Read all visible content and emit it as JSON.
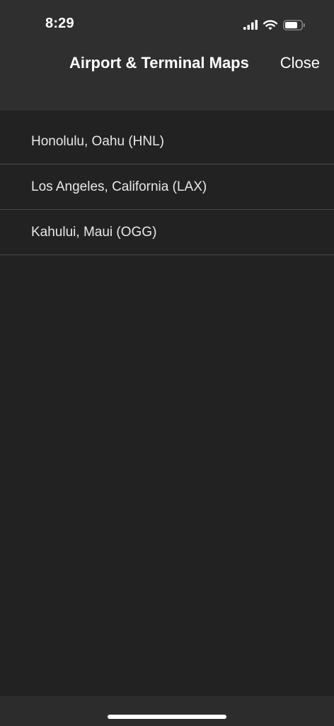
{
  "status_bar": {
    "time": "8:29"
  },
  "nav": {
    "title": "Airport & Terminal Maps",
    "close_label": "Close"
  },
  "airports": [
    {
      "label": "Honolulu, Oahu (HNL)"
    },
    {
      "label": "Los Angeles, California (LAX)"
    },
    {
      "label": "Kahului, Maui (OGG)"
    }
  ],
  "icons": {
    "signal": "cellular-signal-icon",
    "wifi": "wifi-icon",
    "battery": "battery-icon"
  },
  "colors": {
    "background": "#222222",
    "header": "#2f2f2f",
    "divider": "#4a4a4a",
    "text": "#ffffff"
  }
}
